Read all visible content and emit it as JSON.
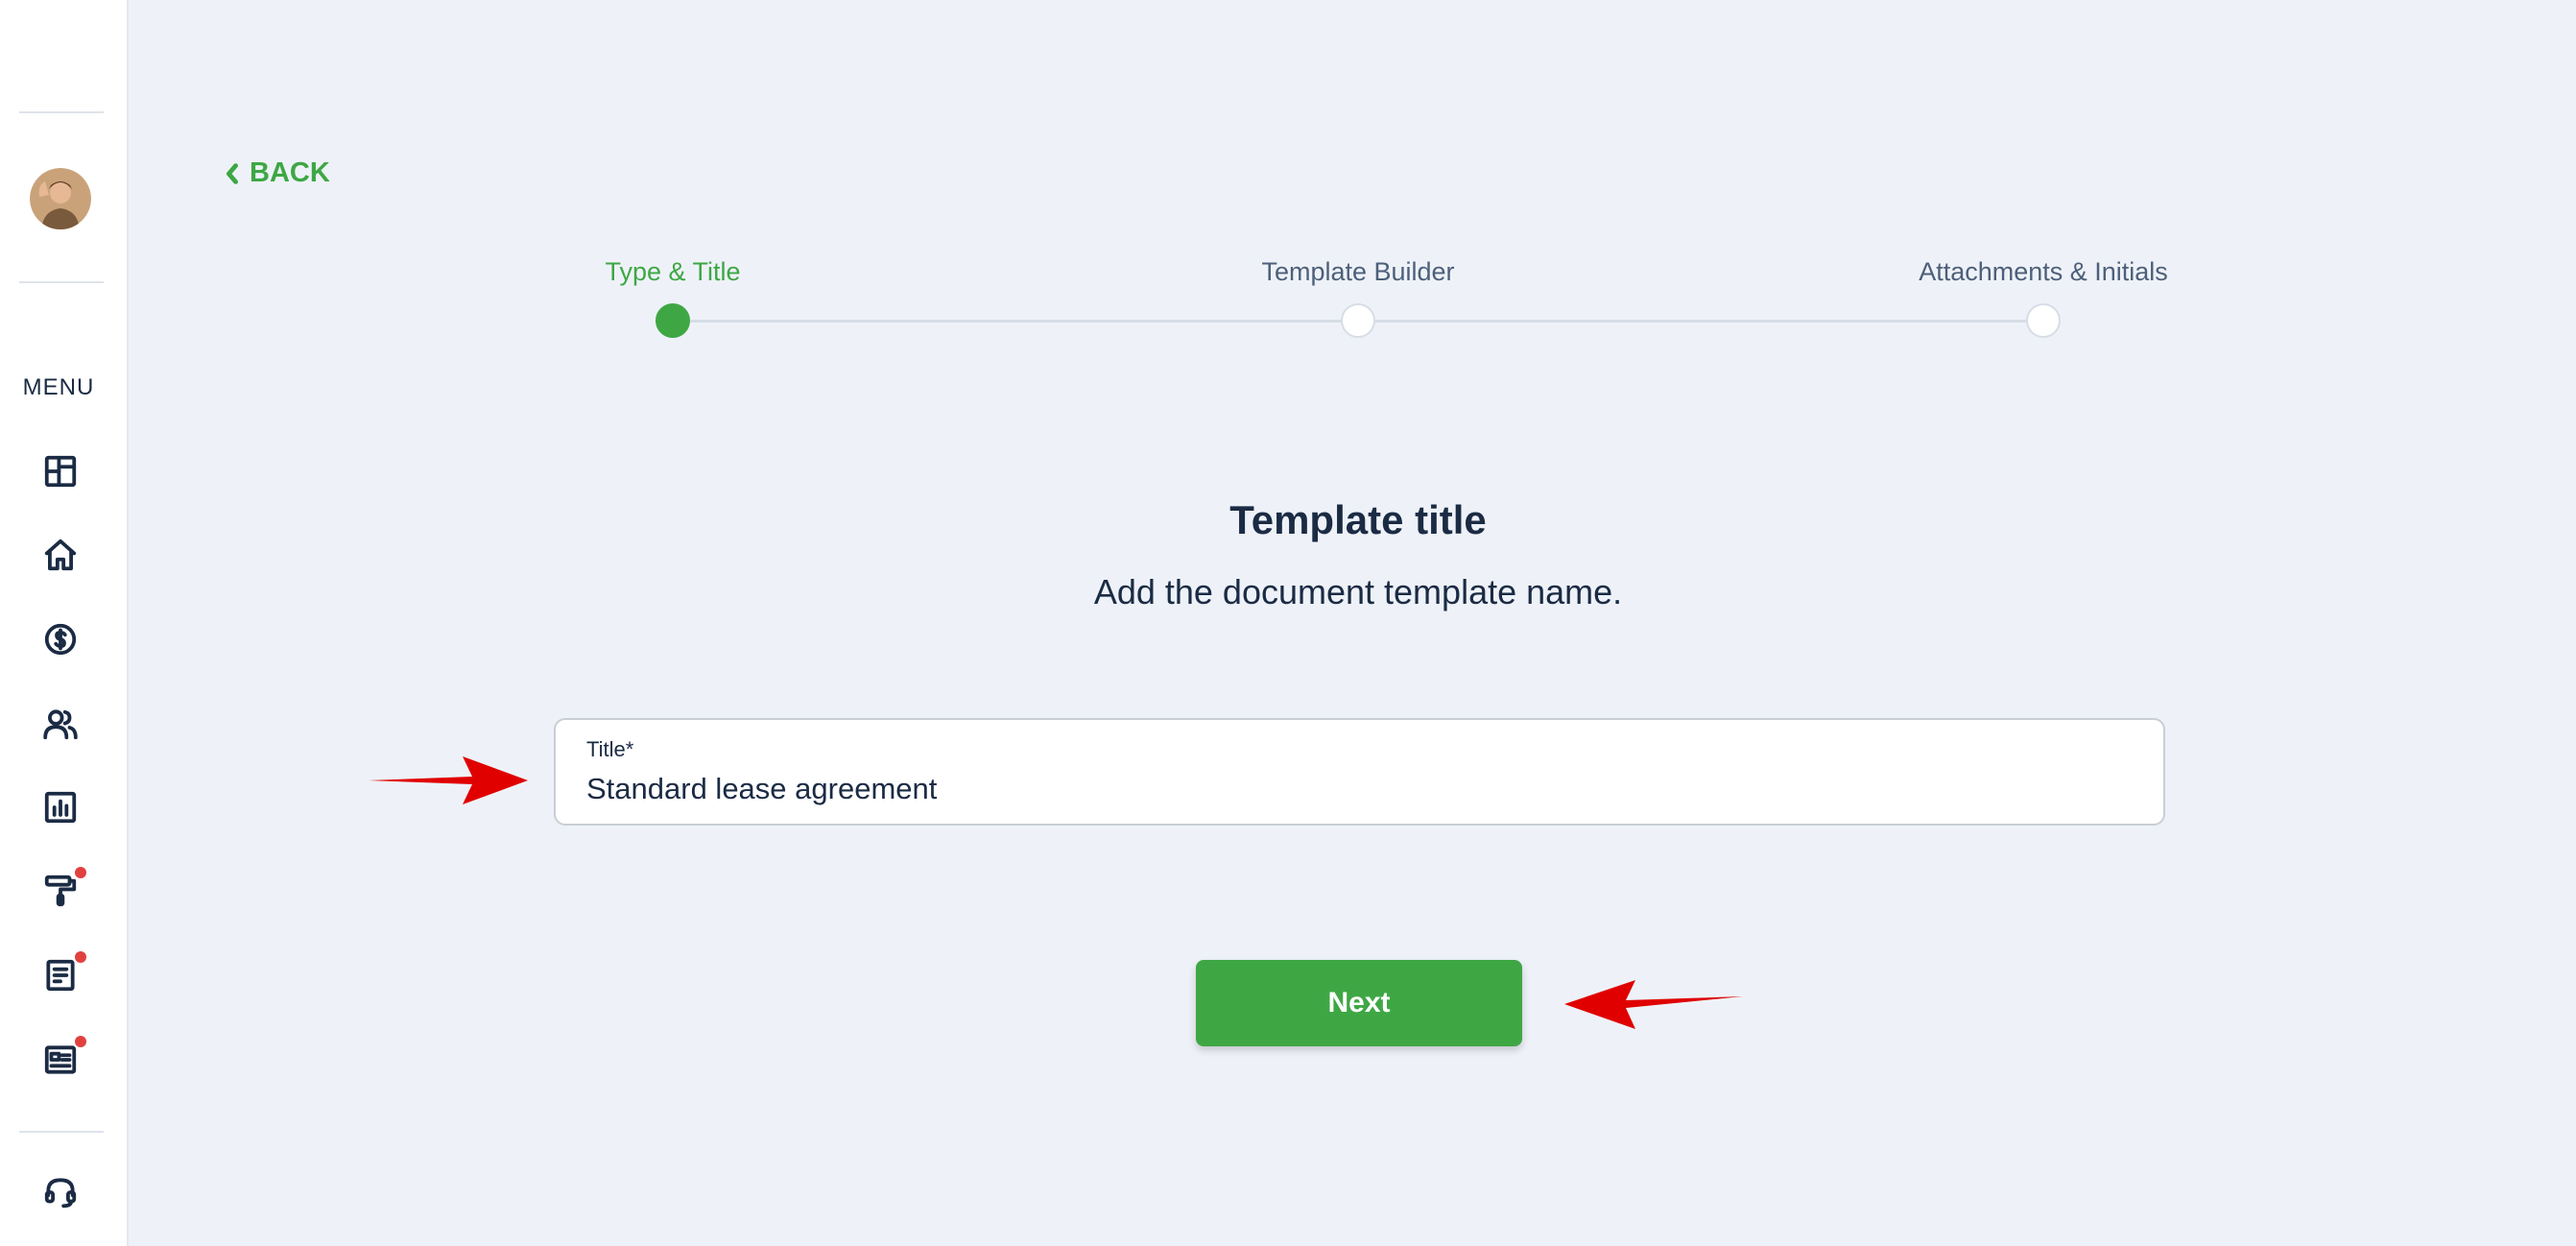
{
  "sidebar": {
    "menu_label": "MENU",
    "items": [
      {
        "icon": "dashboard-icon",
        "badge": false
      },
      {
        "icon": "home-icon",
        "badge": false
      },
      {
        "icon": "dollar-icon",
        "badge": false
      },
      {
        "icon": "users-icon",
        "badge": false
      },
      {
        "icon": "reports-icon",
        "badge": true
      },
      {
        "icon": "paint-roller-icon",
        "badge": true
      },
      {
        "icon": "document-icon",
        "badge": true
      },
      {
        "icon": "news-icon",
        "badge": true
      }
    ],
    "support_icon": "headset-icon"
  },
  "back_label": "BACK",
  "stepper": {
    "steps": [
      {
        "label": "Type & Title",
        "active": true
      },
      {
        "label": "Template Builder",
        "active": false
      },
      {
        "label": "Attachments & Initials",
        "active": false
      }
    ]
  },
  "heading": "Template title",
  "subheading": "Add the document template name.",
  "title_field": {
    "label": "Title*",
    "value": "Standard lease agreement"
  },
  "next_label": "Next",
  "colors": {
    "accent": "#3ea744",
    "text": "#1b2b44",
    "background": "#eef2f8",
    "badge": "#e0413f",
    "annotation_arrow": "#e00000"
  }
}
